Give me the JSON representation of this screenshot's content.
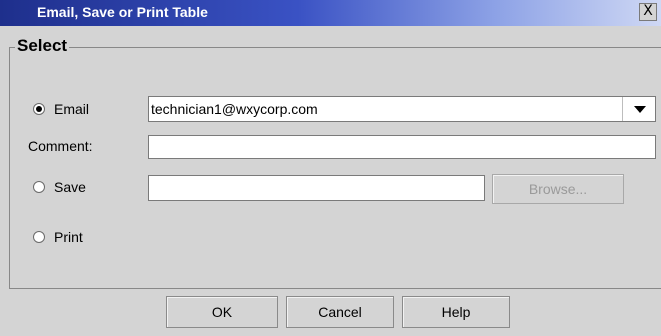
{
  "window": {
    "title": "Email, Save or Print Table",
    "close_label": "X"
  },
  "group": {
    "title": "Select"
  },
  "email": {
    "label": "Email",
    "selected": true,
    "value": "technician1@wxycorp.com"
  },
  "comment": {
    "label": "Comment:",
    "value": ""
  },
  "save": {
    "label": "Save",
    "selected": false,
    "path_value": "",
    "browse_label": "Browse..."
  },
  "print": {
    "label": "Print",
    "selected": false
  },
  "buttons": {
    "ok": "OK",
    "cancel": "Cancel",
    "help": "Help"
  }
}
